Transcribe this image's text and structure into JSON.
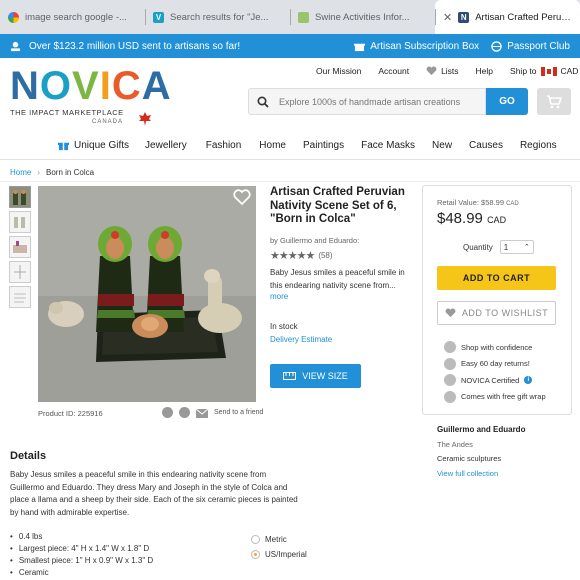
{
  "browser": {
    "tabs": [
      {
        "title": "image search google -...",
        "icon": "google-icon",
        "active": false
      },
      {
        "title": "Search results for \"Je...",
        "icon": "site-v-icon",
        "active": false
      },
      {
        "title": "Swine Activities Infor...",
        "icon": "site-swine-icon",
        "active": false
      },
      {
        "title": "Artisan Crafted Peruvi...",
        "icon": "novica-icon",
        "active": true
      }
    ]
  },
  "promo": {
    "message": "Over $123.2 million USD sent to artisans so far!",
    "subscription": "Artisan Subscription Box",
    "passport": "Passport Club",
    "color": "#2190d6"
  },
  "brand": {
    "name": "NOVICA",
    "tagline": "THE IMPACT MARKETPLACE",
    "country": "CANADA"
  },
  "toplinks": {
    "mission": "Our Mission",
    "account": "Account",
    "lists": "Lists",
    "help": "Help",
    "shipto": "Ship to",
    "currency": "CAD"
  },
  "search": {
    "placeholder": "Explore 1000s of handmade artisan creations",
    "go": "GO"
  },
  "nav": [
    "Unique Gifts",
    "Jewellery",
    "Fashion",
    "Home",
    "Paintings",
    "Face Masks",
    "New",
    "Causes",
    "Regions"
  ],
  "breadcrumb": {
    "home": "Home",
    "current": "Born in Colca"
  },
  "product": {
    "title": "Artisan Crafted Peruvian Nativity Scene Set of 6, \"Born in Colca\"",
    "by_prefix": "by",
    "artist": "Guillermo and Eduardo:",
    "rating": 5,
    "reviews": "(58)",
    "short_desc": "Baby Jesus smiles a peaceful smile in this endearing nativity scene from...",
    "more": "more",
    "stock": "In stock",
    "delivery": "Delivery Estimate",
    "view_size": "VIEW SIZE",
    "id": "Product ID: 225916",
    "send": "Send to a friend"
  },
  "buybox": {
    "retail": "Retail Value: $58.99",
    "retail_cur": "CAD",
    "price": "$48.99",
    "price_cur": "CAD",
    "qty_label": "Quantity",
    "qty_value": "1",
    "add_to_cart": "ADD TO CART",
    "wishlist": "ADD TO WISHLIST",
    "features": [
      {
        "text": "Shop with confidence",
        "icon": "lock-icon"
      },
      {
        "text": "Easy 60 day returns!",
        "icon": "check-icon"
      },
      {
        "text": "NOVICA Certified",
        "icon": "check-icon"
      },
      {
        "text": "Comes with free gift wrap",
        "icon": "gift-icon"
      }
    ]
  },
  "artist_box": {
    "name": "Guillermo and Eduardo",
    "location": "The Andes",
    "category": "Ceramic sculptures",
    "link": "View full collection"
  },
  "details": {
    "heading": "Details",
    "text": "Baby Jesus smiles a peaceful smile in this endearing nativity scene from Guillermo and Eduardo. They dress Mary and Joseph in the style of Colca and place a llama and a sheep by their side. Each of the six ceramic pieces is painted by hand with admirable expertise.",
    "specs": [
      "0.4 lbs",
      "Largest piece: 4\" H x 1.4\" W x 1.8\" D",
      "Smallest piece: 1\" H x 0.9\" W x 1.3\" D",
      "Ceramic"
    ],
    "units": [
      {
        "label": "Metric",
        "selected": false
      },
      {
        "label": "US/Imperial",
        "selected": true
      }
    ]
  }
}
